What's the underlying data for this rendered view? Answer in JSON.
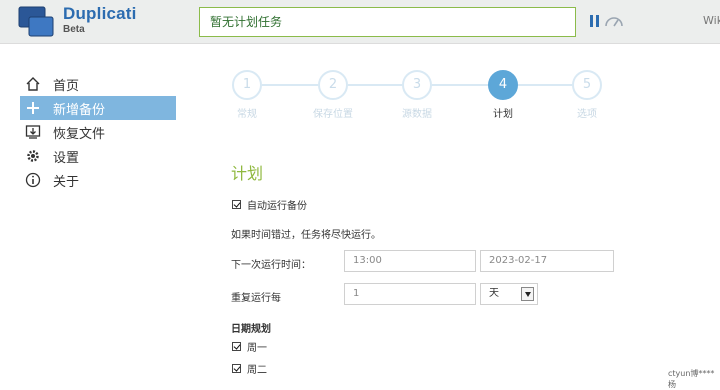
{
  "header": {
    "brand": "Duplicati",
    "brand_sub": "Beta",
    "status": "暂无计划任务",
    "header_cut": "Wiki"
  },
  "sidebar": {
    "items": [
      {
        "label": "首页",
        "icon": "home-icon"
      },
      {
        "label": "新增备份",
        "icon": "plus-icon",
        "active": true
      },
      {
        "label": "恢复文件",
        "icon": "restore-icon"
      },
      {
        "label": "设置",
        "icon": "gear-icon"
      },
      {
        "label": "关于",
        "icon": "info-icon"
      }
    ]
  },
  "steps": [
    {
      "num": "1",
      "label": "常规"
    },
    {
      "num": "2",
      "label": "保存位置"
    },
    {
      "num": "3",
      "label": "源数据"
    },
    {
      "num": "4",
      "label": "计划",
      "active": true
    },
    {
      "num": "5",
      "label": "选项"
    }
  ],
  "form": {
    "title": "计划",
    "auto_run_label": "自动运行备份",
    "hint": "如果时间错过，任务将尽快运行。",
    "next_run_label": "下一次运行时间：",
    "time_value": "13:00",
    "date_value": "2023-02-17",
    "repeat_label": "重复运行每",
    "repeat_value": "1",
    "repeat_unit": "天",
    "days_title": "日期规划",
    "days": [
      "周一",
      "周二"
    ]
  },
  "watermark": "ctyun博****杨",
  "colors": {
    "accent": "#2c6cb0",
    "active_nav": "#7fb6df",
    "step_active": "#5da7d8",
    "title_green": "#8fb83e",
    "status_border": "#8bbb4a"
  }
}
